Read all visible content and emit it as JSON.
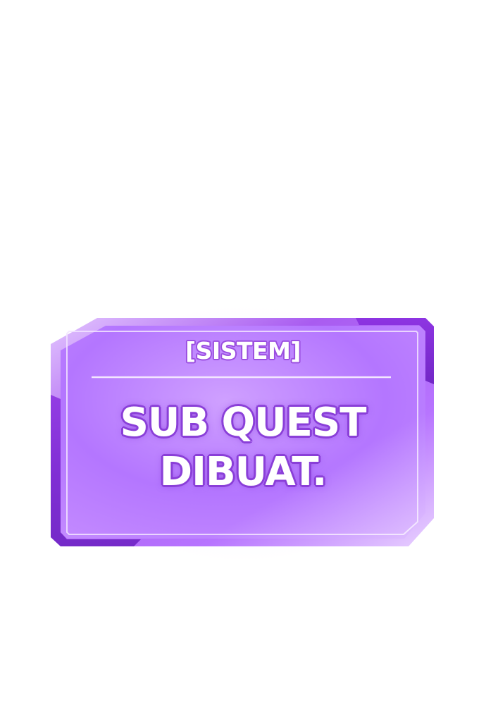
{
  "system_window": {
    "header": "[SISTEM]",
    "message_lines": [
      "SUB QUEST",
      "DIBUAT."
    ]
  },
  "colors": {
    "panel_fill": "#b97aff",
    "panel_edge": "#8b35e0",
    "frame_light": "#d9b3ff",
    "divider": "#f0e2ff",
    "text": "#ffffff",
    "text_outline": "#8a3fd8"
  }
}
